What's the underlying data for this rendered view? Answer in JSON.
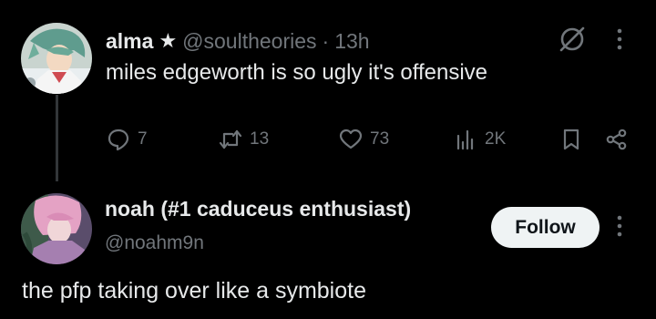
{
  "tweet": {
    "author_name": "alma",
    "author_badge": "★",
    "handle": "@soultheories",
    "separator": "·",
    "time": "13h",
    "text": "miles edgeworth is so ugly it's offensive",
    "stats": {
      "replies": "7",
      "retweets": "13",
      "likes": "73",
      "views": "2K"
    },
    "icons": [
      "grok-icon",
      "more-icon",
      "reply-icon",
      "retweet-icon",
      "like-icon",
      "views-icon",
      "bookmark-icon",
      "share-icon"
    ]
  },
  "reply": {
    "author_name": "noah (#1 caduceus enthusiast)",
    "handle": "@noahm9n",
    "follow_label": "Follow",
    "text": "the pfp taking over like a symbiote"
  },
  "colors": {
    "background": "#000000",
    "primary_text": "#e7e9ea",
    "muted_text": "#71767b",
    "follow_bg": "#eff3f4",
    "thread_line": "#333639"
  }
}
